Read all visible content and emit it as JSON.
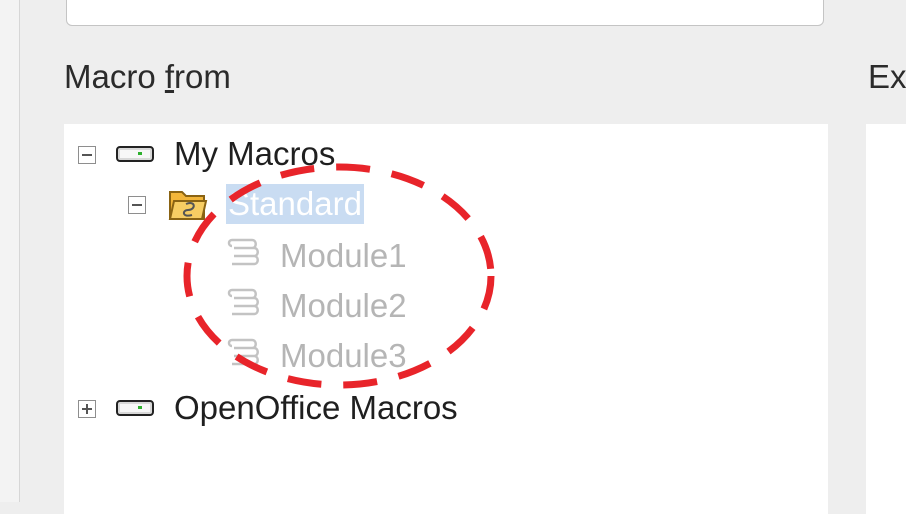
{
  "labels": {
    "macro_from_prefix": "Macro ",
    "macro_from_mnemonic": "f",
    "macro_from_suffix": "rom",
    "right_label": "Ex"
  },
  "tree": {
    "my_macros": "My Macros",
    "standard": "Standard",
    "modules": [
      "Module1",
      "Module2",
      "Module3"
    ],
    "openoffice_macros": "OpenOffice Macros"
  },
  "icons": {
    "library": "drive-icon",
    "folder": "folder-macro-icon",
    "module": "basic-module-icon",
    "collapse": "minus-expander-icon",
    "expand": "plus-expander-icon"
  },
  "colors": {
    "selection": "#c9dcf2",
    "annotation": "#e8242a",
    "folder": "#f2b53a"
  }
}
